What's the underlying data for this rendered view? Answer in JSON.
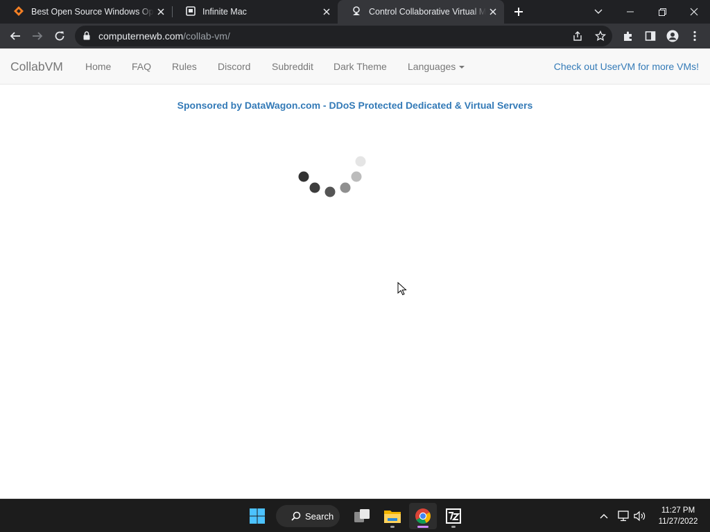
{
  "browser": {
    "tabs": [
      {
        "title": "Best Open Source Windows Oper",
        "icon": "diamond-favicon-icon",
        "active": false
      },
      {
        "title": "Infinite Mac",
        "icon": "page-favicon-icon",
        "active": false
      },
      {
        "title": "Control Collaborative Virtual Mac",
        "icon": "collabvm-favicon-icon",
        "active": true
      }
    ],
    "url_host": "computernewb.com",
    "url_path": "/collab-vm/"
  },
  "navbar": {
    "brand": "CollabVM",
    "links": [
      "Home",
      "FAQ",
      "Rules",
      "Discord",
      "Subreddit",
      "Dark Theme",
      "Languages"
    ],
    "right_link": "Check out UserVM for more VMs!"
  },
  "page": {
    "sponsor": "Sponsored by DataWagon.com - DDoS Protected Dedicated & Virtual Servers"
  },
  "taskbar": {
    "search_label": "Search",
    "apps": [
      "start-icon",
      "task-view-icon",
      "file-explorer-icon",
      "chrome-icon",
      "7zip-icon"
    ],
    "time": "11:27 PM",
    "date": "11/27/2022"
  },
  "colors": {
    "link": "#337ab7",
    "navbar_text": "#777777",
    "tab_strip": "#202124",
    "toolbar": "#35363a",
    "taskbar": "#1c1c1c"
  }
}
